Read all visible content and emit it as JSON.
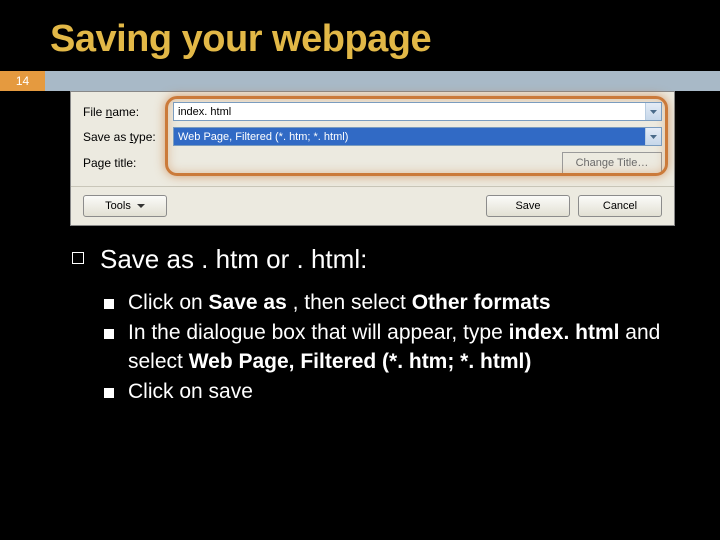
{
  "slide": {
    "title": "Saving your webpage",
    "page_number": "14"
  },
  "dialog": {
    "file_name_label": "File name:",
    "file_name_value": "index. html",
    "save_as_type_label": "Save as type:",
    "save_as_type_value": "Web Page, Filtered (*. htm; *. html)",
    "page_title_label": "Page title:",
    "change_title_label": "Change Title…",
    "tools_label": "Tools",
    "save_label": "Save",
    "cancel_label": "Cancel"
  },
  "body": {
    "heading": "Save as . htm or . html:",
    "bullets": {
      "b1_pre": "Click on ",
      "b1_bold1": "Save as",
      "b1_mid": " , then select ",
      "b1_bold2": "Other formats",
      "b2_pre": "In the dialogue box that will appear, type ",
      "b2_bold1": "index. html",
      "b2_mid2": " and select ",
      "b2_bold2": "Web Page, Filtered (*. htm; *. html)",
      "b3": "Click on save"
    }
  }
}
